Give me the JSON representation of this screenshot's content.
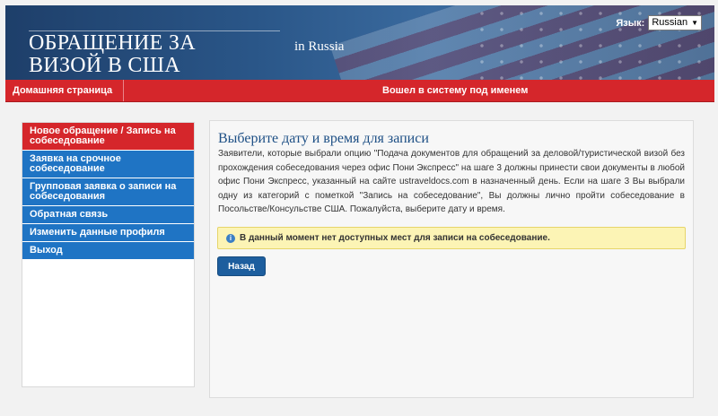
{
  "header": {
    "title": "ОБРАЩЕНИЕ ЗА\nВИЗОЙ В США",
    "country": "in  Russia",
    "language_label": "Язык:",
    "language_value": "Russian"
  },
  "nav": {
    "home": "Домашняя страница",
    "user_status": "Вошел в систему под именем"
  },
  "sidebar": {
    "items": [
      {
        "label": "Новое обращение / Запись на собеседование",
        "active": true
      },
      {
        "label": "Заявка на срочное собеседование",
        "active": false
      },
      {
        "label": "Групповая заявка о записи на собеседования",
        "active": false
      },
      {
        "label": "Обратная связь",
        "active": false
      },
      {
        "label": "Изменить данные профиля",
        "active": false
      },
      {
        "label": "Выход",
        "active": false
      }
    ]
  },
  "main": {
    "title": "Выберите дату и время для записи",
    "description": "Заявители, которые выбрали опцию \"Подача документов для обращений за деловой/туристической визой без прохождения собеседования через офис Пони Экспресс\" на шаге 3 должны принести свои документы в любой офис Пони Экспресс, указанный на сайте ustraveldocs.com в назначенный день. Если на шаге 3 Вы выбрали одну из категорий с пометкой \"Запись на собеседование\", Вы должны лично пройти собеседование в Посольстве/Консульстве США. Пожалуйста, выберите дату и время.",
    "alert": "В данный момент нет доступных мест для записи на собеседование.",
    "back_button": "Назад"
  },
  "colors": {
    "accent_red": "#d5262b",
    "menu_blue": "#1f74c4",
    "title_blue": "#1d4f85",
    "alert_bg": "#fcf4b5",
    "button_blue": "#1d5e9e"
  },
  "icons": {
    "alert": "info-icon",
    "language_dropdown": "triangle-down-icon"
  }
}
